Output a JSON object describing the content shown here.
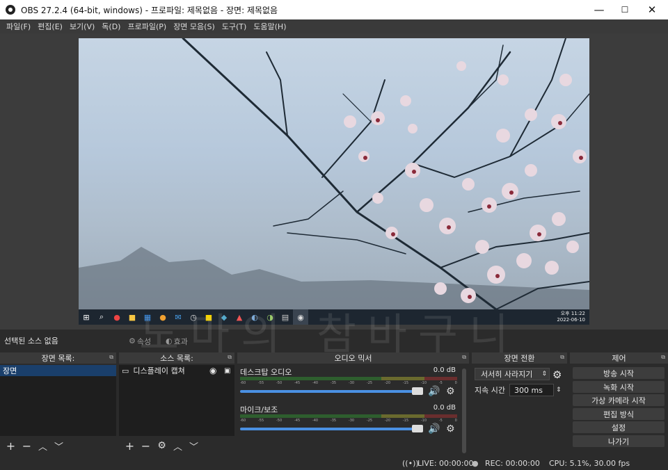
{
  "window": {
    "title": "OBS 27.2.4 (64-bit, windows) - 프로파일: 제목없음 - 장면: 제목없음",
    "minimize": "—",
    "maximize": "☐",
    "close": "✕"
  },
  "menu": [
    "파일(F)",
    "편집(E)",
    "보기(V)",
    "독(D)",
    "프로파일(P)",
    "장면 모음(S)",
    "도구(T)",
    "도움말(H)"
  ],
  "preview": {
    "clock_time": "오후 11:22",
    "clock_date": "2022-06-10"
  },
  "source_bar": {
    "status": "선택된 소스 없음",
    "properties": "속성",
    "filters": "효과"
  },
  "scenes": {
    "header": "장면 목록:",
    "items": [
      "장면"
    ]
  },
  "sources": {
    "header": "소스 목록:",
    "items": [
      "디스플레이 캡쳐"
    ]
  },
  "mixer": {
    "header": "오디오 믹서",
    "channels": [
      {
        "name": "데스크탑 오디오",
        "db": "0.0 dB"
      },
      {
        "name": "마이크/보조",
        "db": "0.0 dB"
      }
    ],
    "ticks": [
      "-60",
      "-55",
      "-50",
      "-45",
      "-40",
      "-35",
      "-30",
      "-25",
      "-20",
      "-15",
      "-10",
      "-5",
      "0"
    ]
  },
  "transitions": {
    "header": "장면 전환",
    "selected": "서서히 사라지기",
    "duration_label": "지속 시간",
    "duration_value": "300 ms"
  },
  "controls": {
    "header": "제어",
    "buttons": [
      "방송 시작",
      "녹화 시작",
      "가상 카메라 시작",
      "편집 방식",
      "설정",
      "나가기"
    ]
  },
  "status": {
    "live": "LIVE: 00:00:00",
    "rec": "REC: 00:00:00",
    "cpu": "CPU: 5.1%, 30.00 fps"
  },
  "watermark": "노마의 참바구니"
}
